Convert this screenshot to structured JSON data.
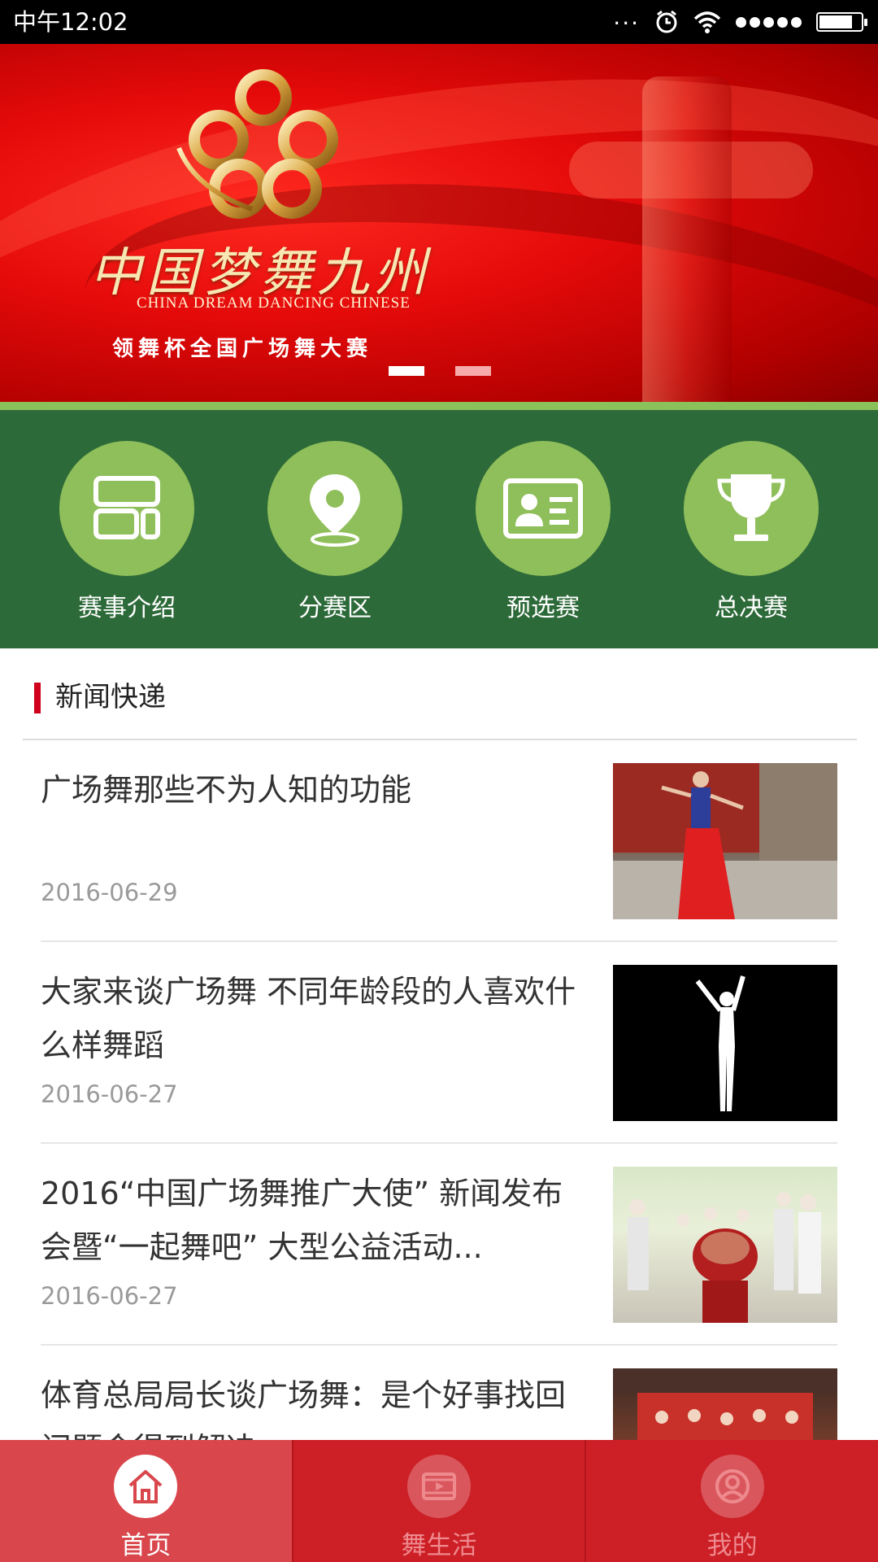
{
  "status_bar": {
    "time": "中午12:02",
    "icons": [
      "more-dots-icon",
      "alarm-icon",
      "wifi-icon",
      "signal-icon",
      "battery-icon"
    ]
  },
  "banner": {
    "title_cn": "中国梦舞九州",
    "title_en": "CHINA DREAM  DANCING CHINESE",
    "subtitle": "领舞杯全国广场舞大赛",
    "slides": 2,
    "active_slide": 1
  },
  "menu": {
    "items": [
      {
        "label": "赛事介绍",
        "icon": "layout-grid-icon"
      },
      {
        "label": "分赛区",
        "icon": "location-pin-icon"
      },
      {
        "label": "预选赛",
        "icon": "id-card-icon"
      },
      {
        "label": "总决赛",
        "icon": "trophy-icon"
      }
    ]
  },
  "news": {
    "section_title": "新闻快递",
    "items": [
      {
        "title": "广场舞那些不为人知的功能",
        "date": "2016-06-29"
      },
      {
        "title": "大家来谈广场舞 不同年龄段的人喜欢什么样舞蹈",
        "date": "2016-06-27"
      },
      {
        "title": "2016“中国广场舞推广大使” 新闻发布会暨“一起舞吧” 大型公益活动...",
        "date": "2016-06-27"
      },
      {
        "title": "体育总局局长谈广场舞：是个好事找回问题会得到解决",
        "date": ""
      }
    ]
  },
  "tabbar": {
    "items": [
      {
        "label": "首页",
        "icon": "home-icon",
        "active": true
      },
      {
        "label": "舞生活",
        "icon": "film-play-icon",
        "active": false
      },
      {
        "label": "我的",
        "icon": "user-profile-icon",
        "active": false
      }
    ]
  },
  "colors": {
    "brand_red": "#cc1f26",
    "menu_green": "#2d6a39",
    "icon_green": "#8fbf5a",
    "accent_line": "#8ac15a"
  }
}
